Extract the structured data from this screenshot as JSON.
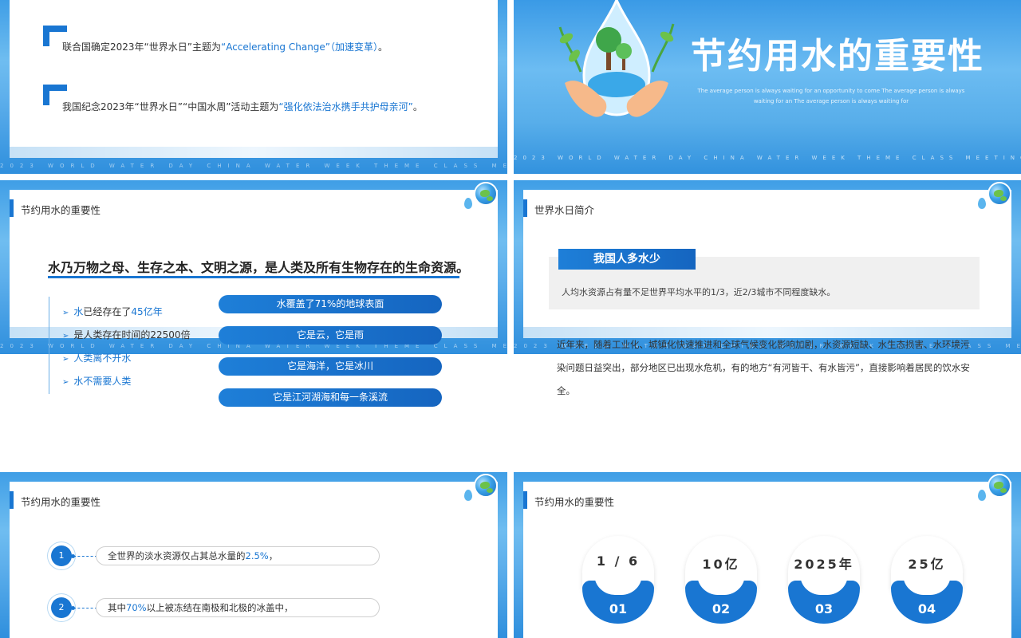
{
  "common": {
    "footer": "2023 WORLD WATER DAY CHINA WATER WEEK THEME CLASS MEETING"
  },
  "slide1": {
    "item1": {
      "prefix": "联合国确定2023年“世界水日”主题为",
      "highlight": "“Accelerating Change”（加速变革）",
      "suffix": "。"
    },
    "item2": {
      "prefix": "我国纪念2023年“世界水日”“中国水周”活动主题为",
      "highlight": "“强化依法治水携手共护母亲河”",
      "suffix": "。"
    }
  },
  "slide2": {
    "title": "节约用水的重要性",
    "subtitle": "The average person is always waiting for an opportunity to come The average person is always waiting for an The average person is always waiting for"
  },
  "slide3": {
    "header": "节约用水的重要性",
    "headline": "水乃万物之母、生存之本、文明之源，是人类及所有生物存在的生命资源。",
    "bullets": [
      {
        "pre": "水",
        "mid": "已经存在了",
        "hl": "45亿年"
      },
      {
        "text": "是人类存在时间的22500倍"
      },
      {
        "text": "人类离不开水"
      },
      {
        "text": "水不需要人类"
      }
    ],
    "pills": [
      "水覆盖了71%的地球表面",
      "它是云，它是雨",
      "它是海洋，它是冰川",
      "它是江河湖海和每一条溪流"
    ]
  },
  "slide4": {
    "header": "世界水日简介",
    "tag": "我国人多水少",
    "tag_text": "人均水资源占有量不足世界平均水平的1/3，近2/3城市不同程度缺水。",
    "paragraph": "近年来，随着工业化、城镇化快速推进和全球气候变化影响加剧，水资源短缺、水生态损害、水环境污染问题日益突出，部分地区已出现水危机，有的地方“有河皆干、有水皆污”，直接影响着居民的饮水安全。"
  },
  "slide5": {
    "header": "节约用水的重要性",
    "rows": [
      {
        "num": "1",
        "pre": "全世界的淡水资源仅占其总水量的",
        "hl": "2.5%",
        "post": "，"
      },
      {
        "num": "2",
        "pre": "其中",
        "hl": "70%",
        "post": "以上被冻结在南极和北极的冰盖中，"
      }
    ]
  },
  "slide6": {
    "header": "节约用水的重要性",
    "stats": [
      {
        "value": "1 / 6",
        "index": "01"
      },
      {
        "value": "10亿",
        "index": "02"
      },
      {
        "value": "2025年",
        "index": "03"
      },
      {
        "value": "25亿",
        "index": "04"
      }
    ]
  },
  "colors": {
    "accent": "#1976d2",
    "bg_blue": "#4aa6ea"
  }
}
